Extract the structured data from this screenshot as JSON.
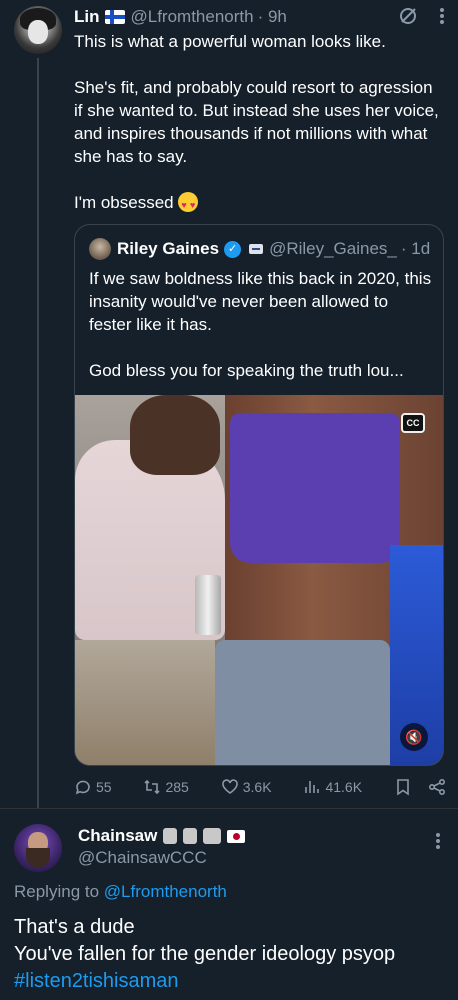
{
  "tweet": {
    "author_name": "Lin",
    "handle": "@Lfromthenorth",
    "time": "· 9h",
    "body_paragraphs": [
      "This is what a powerful woman looks like.",
      "She's fit, and probably could resort to agression if she wanted to. But instead she uses her voice, and inspires thousands if not millions with what she has to say.",
      "I'm obsessed"
    ],
    "icons": [
      "flag-finland-icon",
      "grok-icon",
      "more-icon",
      "heart-eyes-emoji-icon"
    ]
  },
  "quote": {
    "author_name": "Riley Gaines",
    "handle": "@Riley_Gaines_",
    "time": "· 1d",
    "body_paragraphs": [
      "If we saw boldness like this back in 2020, this insanity would've never been allowed to fester like it has.",
      "God bless you for speaking the truth lou..."
    ],
    "media": {
      "cc_label": "CC",
      "mute_symbol": "🔇"
    }
  },
  "actions": {
    "replies": "55",
    "retweets": "285",
    "likes": "3.6K",
    "views": "41.6K"
  },
  "reply": {
    "author_name": "Chainsaw",
    "handle": "@ChainsawCCC",
    "replying_prefix": "Replying to ",
    "replying_handle": "@Lfromthenorth",
    "body_lines": [
      "That's a dude",
      "You've fallen for the gender ideology psyop"
    ],
    "hashtag": "#listen2tishisaman"
  },
  "colors": {
    "background": "#15202b",
    "muted": "#8b98a5",
    "link": "#1d9bf0",
    "border": "#38444d"
  }
}
